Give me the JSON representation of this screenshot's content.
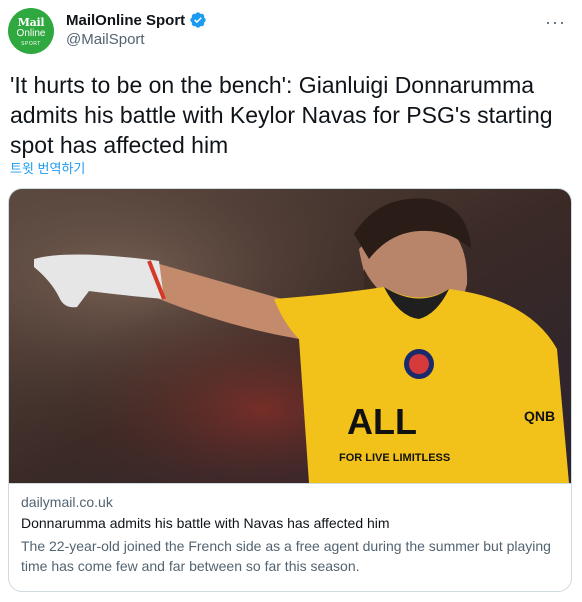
{
  "account": {
    "display_name": "MailOnline Sport",
    "handle": "@MailSport",
    "avatar_line1": "Mail",
    "avatar_line2": "Online",
    "avatar_line3": "SPORT",
    "verified_icon": "verified-badge-icon",
    "more_icon": "more-options-icon"
  },
  "tweet": {
    "text": "'It hurts to be on the bench': Gianluigi Donnarumma admits his battle with Keylor Navas for PSG's starting spot has affected him",
    "translate_label": "트윗 번역하기"
  },
  "card": {
    "domain": "dailymail.co.uk",
    "title": "Donnarumma admits his battle with Navas has affected him",
    "description": "The 22-year-old joined the French side as a free agent during the summer but playing time has come few and far between so far this season.",
    "image_jersey_text": "ALL",
    "image_slogan": "FOR LIVE LIMITLESS",
    "image_sponsor_right": "QNB"
  },
  "colors": {
    "accent": "#1d9bf0",
    "brand_green": "#2fa840",
    "jersey_yellow": "#f3c21a"
  }
}
